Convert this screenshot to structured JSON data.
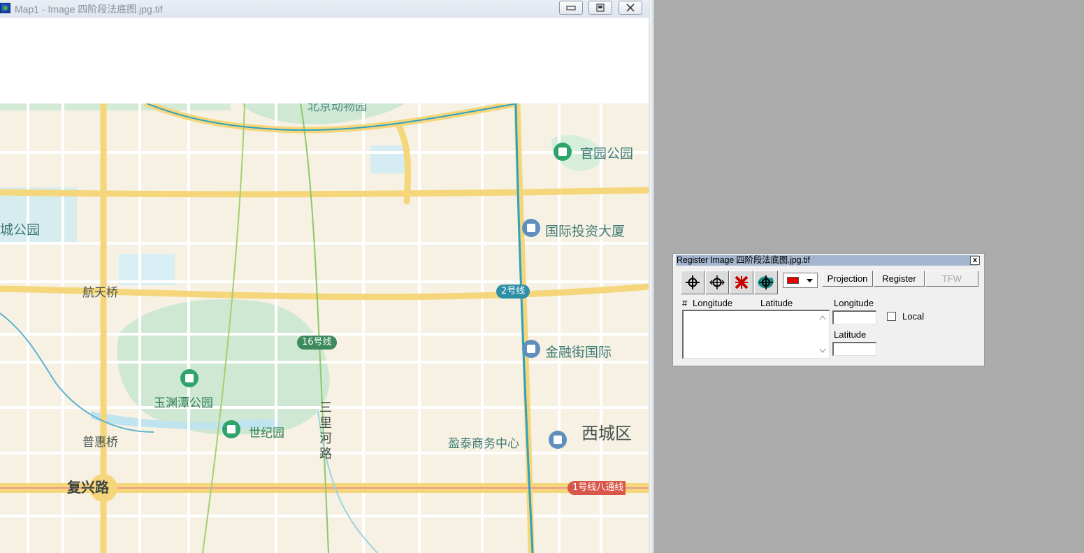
{
  "map_window": {
    "title": "Map1 - Image 四阶段法底图.jpg.tif",
    "buttons": {
      "minimize_icon": "minimize-icon",
      "restore_icon": "restore-icon",
      "close_icon": "close-icon"
    }
  },
  "map": {
    "partial_top_label": "北京动物园",
    "labels": {
      "guanyuan_park": "官园公园",
      "intl_investment_tower": "国际投资大厦",
      "park_left": "城公园",
      "hangtian_bridge": "航天桥",
      "line2": "2号线",
      "line16": "16号线",
      "financial_street": "金融街国际",
      "yuyuantan_park": "玉渊潭公园",
      "world_park": "世纪园",
      "sanlihe_road": "三\n里\n河\n路",
      "yingtai_center": "盈泰商务中心",
      "xicheng_district": "西城区",
      "puhui_bridge": "普惠桥",
      "fuxing_road": "复兴路",
      "line1_batong": "1号线八通线"
    },
    "colors": {
      "road_major": "#f5d67a",
      "road_minor": "#ffffff",
      "green": "#cfe8d4",
      "water": "#c9e9f2",
      "metro": "#2ea2c0",
      "background": "#f6f1e3"
    }
  },
  "register_dialog": {
    "title": "Register Image 四阶段法底图.jpg.tif",
    "close_label": "x",
    "tools": [
      "add-point-icon",
      "move-point-icon",
      "delete-point-icon",
      "zoom-point-icon"
    ],
    "color": "#e60000",
    "buttons": {
      "projection": "Projection",
      "register": "Register",
      "tfw": "TFW"
    },
    "columns": {
      "number": "#",
      "longitude": "Longitude",
      "latitude": "Latitude"
    },
    "fields": {
      "longitude_label": "Longitude",
      "latitude_label": "Latitude",
      "longitude_value": "",
      "latitude_value": ""
    },
    "local_label": "Local",
    "local_checked": false
  }
}
